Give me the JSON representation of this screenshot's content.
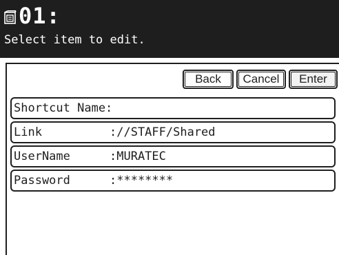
{
  "header": {
    "icon": "address-book-icon",
    "title": "01:",
    "subtitle": "Select item to edit."
  },
  "buttons": {
    "back": "Back",
    "cancel": "Cancel",
    "enter": "Enter"
  },
  "items": [
    {
      "label": "Shortcut Name:",
      "value": ""
    },
    {
      "label": "Link",
      "value": "://STAFF/Shared"
    },
    {
      "label": "UserName",
      "value": ":MURATEC"
    },
    {
      "label": "Password",
      "value": ":********"
    }
  ],
  "colors": {
    "header_bg": "#1e1e1e",
    "text": "#1e1e1e",
    "background": "#ffffff"
  }
}
